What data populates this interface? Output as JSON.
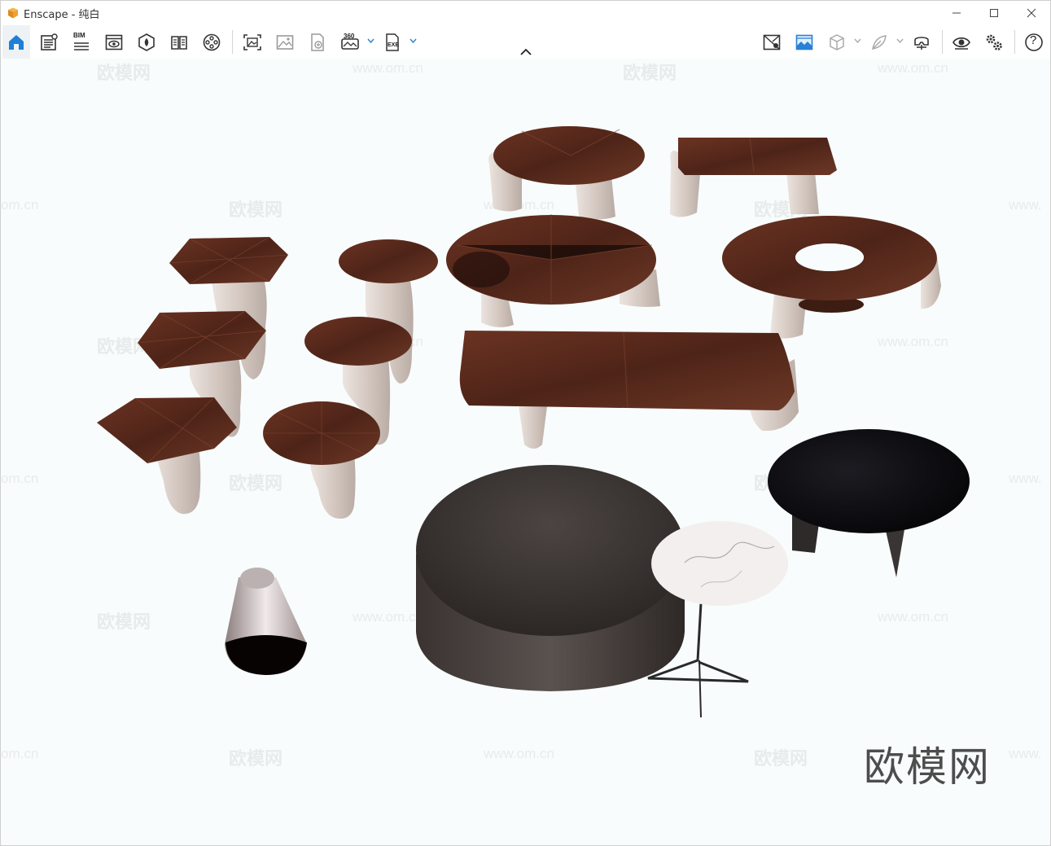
{
  "window": {
    "title": "Enscape - 纯白",
    "brand_color": "#e8a33a"
  },
  "toolbar": {
    "left_icons": [
      "home-icon",
      "assets-icon",
      "bim-icon",
      "views-icon",
      "materials-icon",
      "book-icon",
      "video-icon"
    ],
    "middle_icons": [
      "screenshot-icon",
      "image-icon",
      "export-icon",
      "panorama-360-icon",
      "exe-export-icon"
    ],
    "right_icons": [
      "map-pin-icon",
      "sky-icon",
      "box-icon",
      "feather-icon",
      "vr-headset-icon",
      "eye-icon",
      "settings-icon",
      "help-icon"
    ],
    "bim_label": "BIM",
    "pano_label": "360",
    "exe_label": "EXE",
    "help_label": "?"
  },
  "watermarks": {
    "text_cn": "欧模网",
    "text_url": "www.om.cn",
    "text_url_partial": "om.cn",
    "text_url_left": "www.",
    "logo_text": "欧模网"
  },
  "colors": {
    "wood": "#5a2a1c",
    "wood_light": "#7a3e2a",
    "base_beige": "#d4c8c1",
    "leather": "#3b3533",
    "marble": "#f1eeed",
    "black_top": "#111114"
  }
}
